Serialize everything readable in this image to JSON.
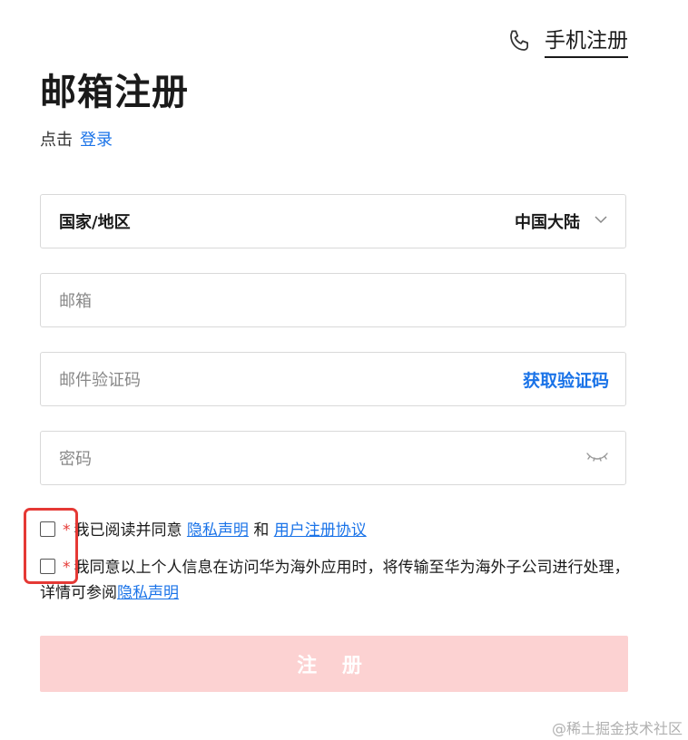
{
  "header": {
    "phone_register_label": "手机注册",
    "title": "邮箱注册",
    "login_prefix": "点击",
    "login_link": "登录"
  },
  "form": {
    "region_label": "国家/地区",
    "region_value": "中国大陆",
    "email_placeholder": "邮箱",
    "code_placeholder": "邮件验证码",
    "get_code_label": "获取验证码",
    "password_placeholder": "密码"
  },
  "consents": {
    "star": "*",
    "c1_text": "我已阅读并同意",
    "c1_link1": "隐私声明",
    "c1_and": "和",
    "c1_link2": "用户注册协议",
    "c2_text": "我同意以上个人信息在访问华为海外应用时，将传输至华为海外子公司进行处理，详情可参阅",
    "c2_link": "隐私声明"
  },
  "actions": {
    "register_label": "注 册"
  },
  "watermark": "@稀土掘金技术社区",
  "colors": {
    "link": "#1a73e8",
    "required_star": "#e53935",
    "register_disabled_bg": "#fcd2d2",
    "highlight": "#e53935"
  },
  "icons": {
    "phone": "phone-icon",
    "chevron": "chevron-down-icon",
    "eye": "eye-closed-icon"
  }
}
